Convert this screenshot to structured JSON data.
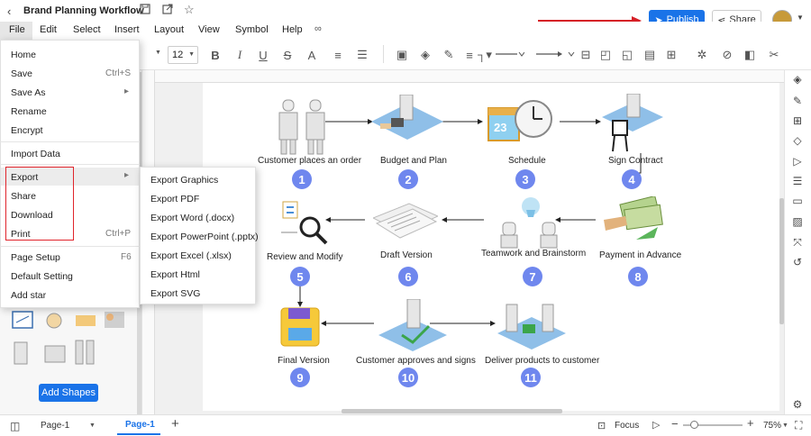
{
  "app": {
    "doc_title": "Brand Planning Workflow",
    "publish_label": "Publish",
    "share_label": "Share"
  },
  "menubar": [
    "File",
    "Edit",
    "Select",
    "Insert",
    "Layout",
    "View",
    "Symbol",
    "Help"
  ],
  "toolbar": {
    "font_size": "12"
  },
  "file_menu": {
    "items": [
      {
        "label": "Home",
        "shortcut": ""
      },
      {
        "label": "Save",
        "shortcut": "Ctrl+S"
      },
      {
        "label": "Save As",
        "shortcut": "▸"
      },
      {
        "label": "Rename",
        "shortcut": ""
      },
      {
        "label": "Encrypt",
        "shortcut": ""
      },
      {
        "label": "Import Data",
        "shortcut": ""
      },
      {
        "label": "Export",
        "shortcut": "▸"
      },
      {
        "label": "Share",
        "shortcut": ""
      },
      {
        "label": "Download",
        "shortcut": ""
      },
      {
        "label": "Print",
        "shortcut": "Ctrl+P"
      },
      {
        "label": "Page Setup",
        "shortcut": "F6"
      },
      {
        "label": "Default Setting",
        "shortcut": ""
      },
      {
        "label": "Add star",
        "shortcut": ""
      }
    ]
  },
  "export_submenu": [
    "Export Graphics",
    "Export PDF",
    "Export Word (.docx)",
    "Export PowerPoint (.pptx)",
    "Export Excel (.xlsx)",
    "Export Html",
    "Export SVG"
  ],
  "left_panel": {
    "add_shapes_label": "Add Shapes"
  },
  "diagram": {
    "steps": [
      {
        "n": "1",
        "label": "Customer places an order"
      },
      {
        "n": "2",
        "label": "Budget and Plan"
      },
      {
        "n": "3",
        "label": "Schedule"
      },
      {
        "n": "4",
        "label": "Sign Contract"
      },
      {
        "n": "5",
        "label": "Review and Modify"
      },
      {
        "n": "6",
        "label": "Draft Version"
      },
      {
        "n": "7",
        "label": "Teamwork and Brainstorm"
      },
      {
        "n": "8",
        "label": "Payment in Advance"
      },
      {
        "n": "9",
        "label": "Final Version"
      },
      {
        "n": "10",
        "label": "Customer approves and signs"
      },
      {
        "n": "11",
        "label": "Deliver products to customer"
      }
    ],
    "calendar_day": "23"
  },
  "statusbar": {
    "page_selector": "Page-1",
    "page_tab": "Page-1",
    "focus_label": "Focus",
    "zoom": "75%"
  },
  "colors": {
    "accent": "#1a73e8",
    "step_badge": "#6f87ee",
    "highlight_red": "#e0242b",
    "annotation_arrow": "#d61f26"
  }
}
